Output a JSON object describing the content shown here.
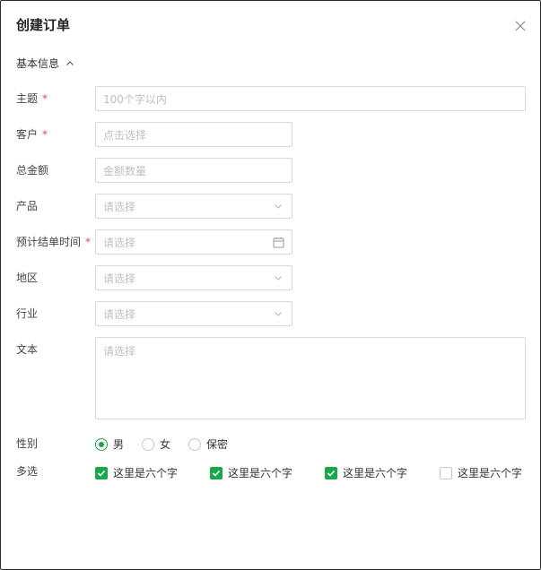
{
  "dialog": {
    "title": "创建订单",
    "close_icon": "close-icon"
  },
  "section": {
    "label": "基本信息",
    "expanded": true,
    "toggle_icon": "chevron-up-icon"
  },
  "form": {
    "subject": {
      "label": "主题",
      "required": "*",
      "placeholder": "100个字以内"
    },
    "customer": {
      "label": "客户",
      "required": "*",
      "placeholder": "点击选择"
    },
    "total_amount": {
      "label": "总金额",
      "placeholder": "金额数量"
    },
    "product": {
      "label": "产品",
      "placeholder": "请选择",
      "icon": "chevron-down-icon"
    },
    "close_date": {
      "label": "预计结单时间",
      "required": "*",
      "placeholder": "请选择",
      "icon": "calendar-icon"
    },
    "region": {
      "label": "地区",
      "placeholder": "请选择",
      "icon": "chevron-down-icon"
    },
    "industry": {
      "label": "行业",
      "placeholder": "请选择",
      "icon": "chevron-down-icon"
    },
    "text": {
      "label": "文本",
      "placeholder": "请选择"
    },
    "gender": {
      "label": "性别",
      "options": [
        {
          "label": "男",
          "selected": true
        },
        {
          "label": "女",
          "selected": false
        },
        {
          "label": "保密",
          "selected": false
        }
      ]
    },
    "multi": {
      "label": "多选",
      "options": [
        {
          "label": "这里是六个字",
          "checked": true
        },
        {
          "label": "这里是六个字",
          "checked": true
        },
        {
          "label": "这里是六个字",
          "checked": true
        },
        {
          "label": "这里是六个字",
          "checked": false
        }
      ]
    }
  },
  "colors": {
    "accent": "#18a948",
    "required": "#e5484d",
    "border": "#d9d9d9",
    "placeholder": "#bfbfbf"
  }
}
